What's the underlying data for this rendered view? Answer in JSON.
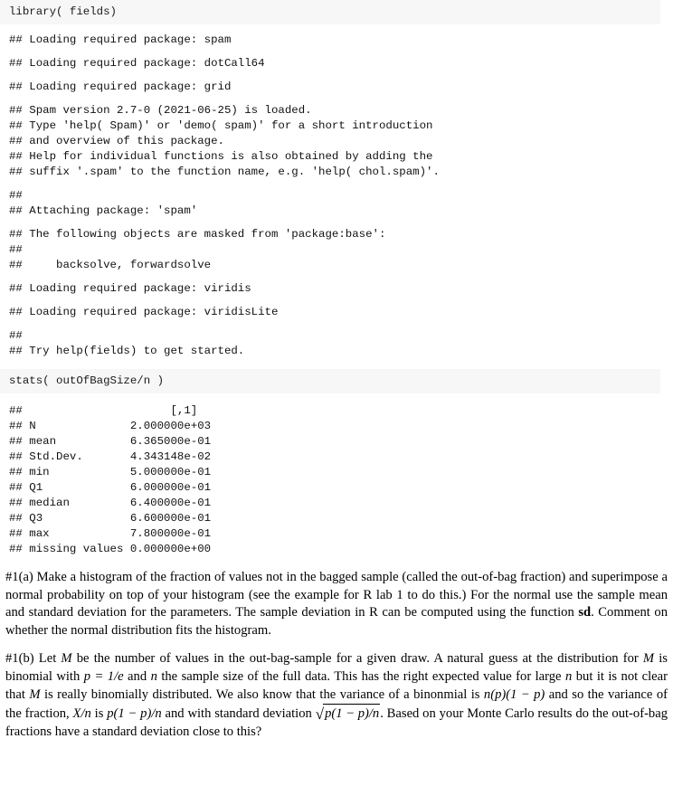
{
  "document": {
    "type": "rmarkdown-knitr-output",
    "code_background": "#f7f7f7",
    "text_color": "#000000"
  },
  "chunk1": {
    "input": "library( fields)",
    "outputs": [
      "## Loading required package: spam",
      "## Loading required package: dotCall64",
      "## Loading required package: grid",
      "## Spam version 2.7-0 (2021-06-25) is loaded.\n## Type 'help( Spam)' or 'demo( spam)' for a short introduction\n## and overview of this package.\n## Help for individual functions is also obtained by adding the\n## suffix '.spam' to the function name, e.g. 'help( chol.spam)'.",
      "## \n## Attaching package: 'spam'",
      "## The following objects are masked from 'package:base':\n## \n##     backsolve, forwardsolve",
      "## Loading required package: viridis",
      "## Loading required package: viridisLite",
      "## \n## Try help(fields) to get started."
    ]
  },
  "chunk2": {
    "input": "stats( outOfBagSize/n )",
    "output": "##                      [,1]\n## N              2.000000e+03\n## mean           6.365000e-01\n## Std.Dev.       4.343148e-02\n## min            5.000000e-01\n## Q1             6.000000e-01\n## median         6.400000e-01\n## Q3             6.600000e-01\n## max            7.800000e-01\n## missing values 0.000000e+00",
    "stats_table": {
      "column_header": "[,1]",
      "rows": [
        {
          "label": "N",
          "value": "2.000000e+03"
        },
        {
          "label": "mean",
          "value": "6.365000e-01"
        },
        {
          "label": "Std.Dev.",
          "value": "4.343148e-02"
        },
        {
          "label": "min",
          "value": "5.000000e-01"
        },
        {
          "label": "Q1",
          "value": "6.000000e-01"
        },
        {
          "label": "median",
          "value": "6.400000e-01"
        },
        {
          "label": "Q3",
          "value": "6.600000e-01"
        },
        {
          "label": "max",
          "value": "7.800000e-01"
        },
        {
          "label": "missing values",
          "value": "0.000000e+00"
        }
      ]
    }
  },
  "problem_a": {
    "label": "#1(a)",
    "text_1": "Make a histogram of the fraction of values not in the bagged sample (called the out-of-bag fraction) and superimpose a normal probability on top of your histogram (see the example for R lab 1 to do this.) For the normal use the sample mean and standard deviation for the parameters. The sample deviation in R can be computed using the function ",
    "bold_fn": "sd",
    "text_2": ". Comment on whether the normal distribution fits the histogram."
  },
  "problem_b": {
    "label": "#1(b)",
    "t1": "Let ",
    "m1": "M",
    "t2": " be the number of values in the out-bag-sample for a given draw. A natural guess at the distribution for ",
    "m2": "M",
    "t3": " is binomial with ",
    "m3": "p = 1/e",
    "t4": " and ",
    "m4": "n",
    "t5": " the sample size of the full data. This has the right expected value for large ",
    "m5": "n",
    "t6": " but it is not clear that ",
    "m6": "M",
    "t7": " is really binomially distributed. We also know that the variance of a binonmial is ",
    "m7": "n(p)(1 − p)",
    "t8": " and so the variance of the fraction, ",
    "m8": "X/n",
    "t9": " is ",
    "m9": "p(1 − p)/n",
    "t10": " and with standard deviation ",
    "radical": "√",
    "m10": "p(1 − p)/n",
    "t11": ". Based on your Monte Carlo results do the out-of-bag fractions have a standard deviation close to this?"
  }
}
